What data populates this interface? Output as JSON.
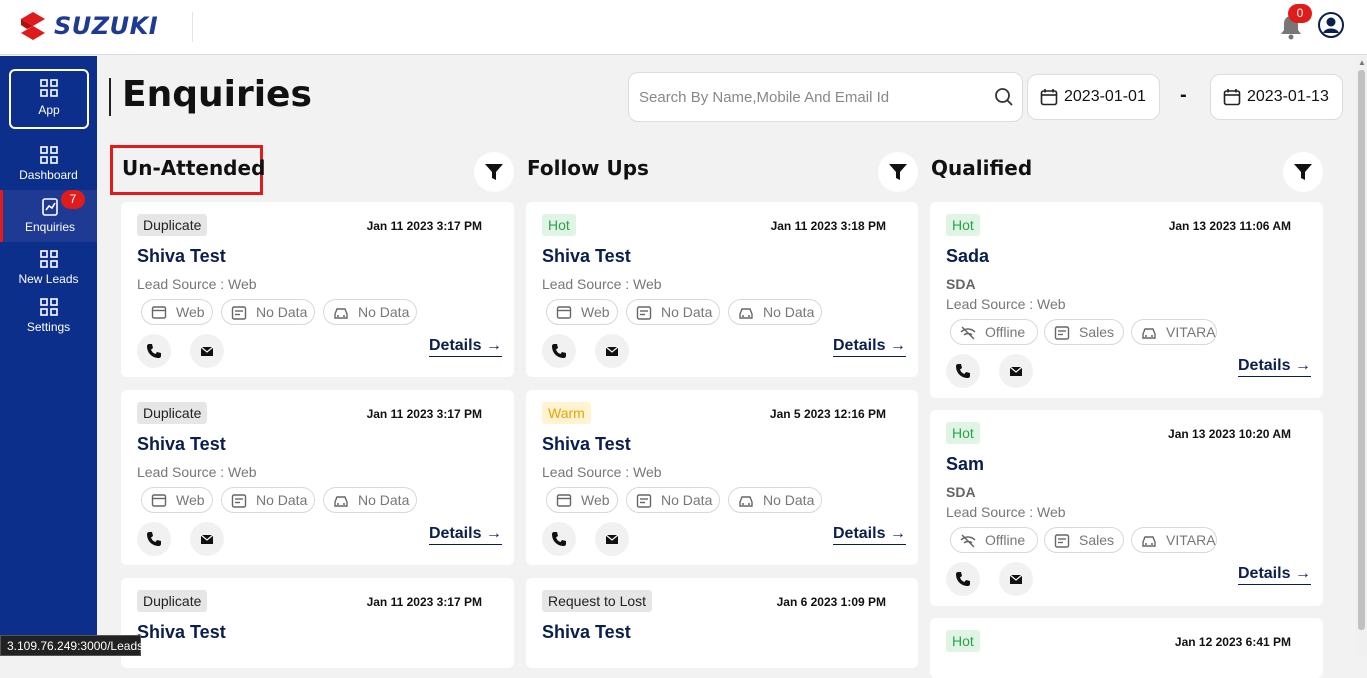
{
  "header": {
    "brand": "SUZUKI",
    "notification_count": "0"
  },
  "sidebar": {
    "items": [
      {
        "label": "App"
      },
      {
        "label": "Dashboard"
      },
      {
        "label": "Enquiries",
        "badge": "7"
      },
      {
        "label": "New Leads"
      },
      {
        "label": "Settings"
      }
    ]
  },
  "page": {
    "title": "Enquiries",
    "search_placeholder": "Search By Name,Mobile And Email Id",
    "date_from": "2023-01-01",
    "date_separator": "-",
    "date_to": "2023-01-13"
  },
  "columns": [
    {
      "title": "Un-Attended",
      "cards": [
        {
          "tag": "Duplicate",
          "date": "Jan 11 2023 3:17 PM",
          "name": "Shiva Test",
          "source": "Lead Source : Web",
          "pills": [
            "Web",
            "No Data",
            "No Data"
          ],
          "details": "Details"
        },
        {
          "tag": "Duplicate",
          "date": "Jan 11 2023 3:17 PM",
          "name": "Shiva Test",
          "source": "Lead Source : Web",
          "pills": [
            "Web",
            "No Data",
            "No Data"
          ],
          "details": "Details"
        },
        {
          "tag": "Duplicate",
          "date": "Jan 11 2023 3:17 PM",
          "name": "Shiva Test"
        }
      ]
    },
    {
      "title": "Follow Ups",
      "cards": [
        {
          "tag": "Hot",
          "date": "Jan 11 2023 3:18 PM",
          "name": "Shiva Test",
          "source": "Lead Source : Web",
          "pills": [
            "Web",
            "No Data",
            "No Data"
          ],
          "details": "Details"
        },
        {
          "tag": "Warm",
          "date": "Jan 5 2023 12:16 PM",
          "name": "Shiva Test",
          "source": "Lead Source : Web",
          "pills": [
            "Web",
            "No Data",
            "No Data"
          ],
          "details": "Details"
        },
        {
          "tag": "Request to Lost",
          "date": "Jan 6 2023 1:09 PM",
          "name": "Shiva Test"
        }
      ]
    },
    {
      "title": "Qualified",
      "cards": [
        {
          "tag": "Hot",
          "date": "Jan 13 2023 11:06 AM",
          "name": "Sada",
          "org": "SDA",
          "source": "Lead Source : Web",
          "pills": [
            "Offline",
            "Sales",
            "VITARA"
          ],
          "details": "Details"
        },
        {
          "tag": "Hot",
          "date": "Jan 13 2023 10:20 AM",
          "name": "Sam",
          "org": "SDA",
          "source": "Lead Source : Web",
          "pills": [
            "Offline",
            "Sales",
            "VITARA"
          ],
          "details": "Details"
        },
        {
          "tag": "Hot",
          "date": "Jan 12 2023 6:41 PM"
        }
      ]
    }
  ],
  "status_bar": {
    "url": "3.109.76.249:3000/Leads"
  }
}
